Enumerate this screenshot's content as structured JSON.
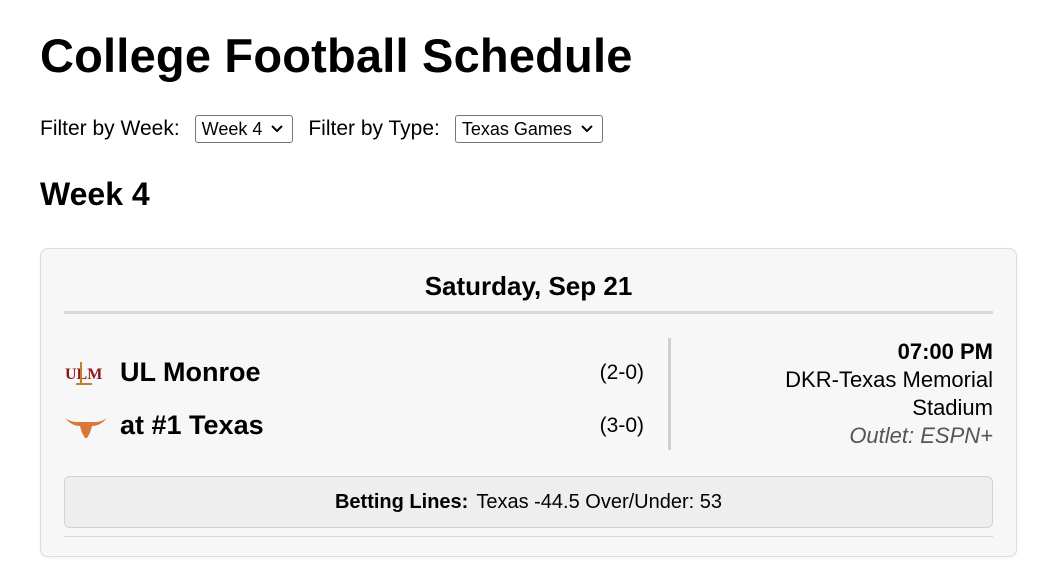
{
  "title": "College Football Schedule",
  "filters": {
    "week_label": "Filter by Week:",
    "week_value": "Week 4",
    "type_label": "Filter by Type:",
    "type_value": "Texas Games"
  },
  "week_heading": "Week 4",
  "game": {
    "date": "Saturday, Sep 21",
    "away": {
      "name": "UL Monroe",
      "record": "(2-0)",
      "logo": "ulm-logo",
      "logo_text": "ULM",
      "color": "#8a1a1a"
    },
    "home": {
      "name": "at #1 Texas",
      "record": "(3-0)",
      "logo": "longhorn-logo",
      "color": "#d9773b"
    },
    "time": "07:00 PM",
    "venue": "DKR-Texas Memorial Stadium",
    "outlet": "Outlet: ESPN+",
    "betting_label": "Betting Lines:",
    "betting_value": "Texas -44.5 Over/Under: 53"
  }
}
